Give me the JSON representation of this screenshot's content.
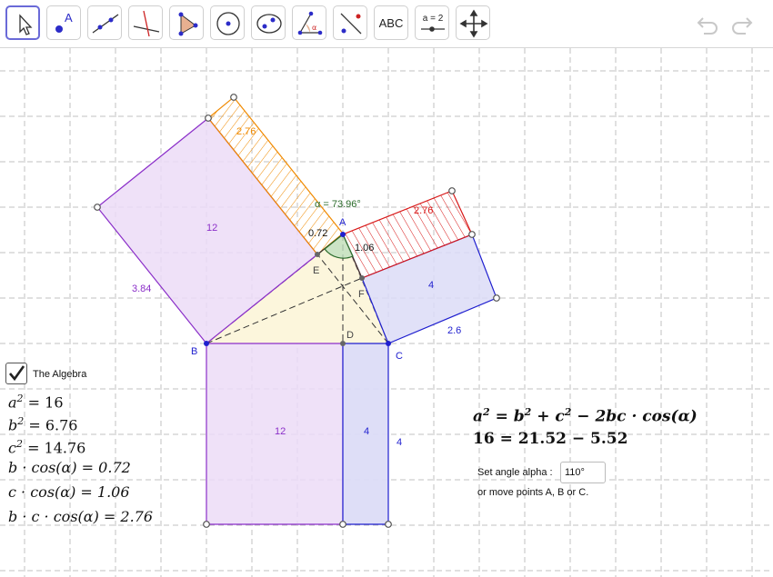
{
  "toolbar": {
    "tools": [
      {
        "name": "move-tool",
        "icon": "cursor-icon"
      },
      {
        "name": "point-tool",
        "icon": "point-icon",
        "label": "A"
      },
      {
        "name": "line-tool",
        "icon": "line-icon"
      },
      {
        "name": "perpendicular-tool",
        "icon": "perpendicular-icon"
      },
      {
        "name": "polygon-tool",
        "icon": "polygon-icon"
      },
      {
        "name": "circle-tool",
        "icon": "circle-icon"
      },
      {
        "name": "ellipse-tool",
        "icon": "ellipse-icon"
      },
      {
        "name": "angle-tool",
        "icon": "angle-icon",
        "label": "α"
      },
      {
        "name": "reflect-tool",
        "icon": "reflect-icon"
      },
      {
        "name": "text-tool",
        "icon": "text-icon",
        "label": "ABC"
      },
      {
        "name": "slider-tool",
        "icon": "slider-icon",
        "label": "a = 2"
      },
      {
        "name": "move-view-tool",
        "icon": "move-view-icon"
      }
    ],
    "undo_icon": "undo-icon",
    "redo_icon": "redo-icon"
  },
  "geometry": {
    "points": {
      "A": "A",
      "B": "B",
      "C": "C",
      "D": "D",
      "E": "E",
      "F": "F"
    },
    "alpha_label": "α = 73.96°",
    "values": {
      "orange_rect_label": "2.76",
      "red_rect_label": "2.76",
      "left_square_label": "12",
      "left_side_label": "3.84",
      "right_square_label": "4",
      "right_side_label": "2.6",
      "bottom_left_label": "12",
      "bottom_right_label": "4",
      "bottom_side_label": "4",
      "proj_b_label": "0.72",
      "proj_c_label": "1.06"
    }
  },
  "algebra": {
    "checkbox_label": "The Algebra",
    "checked": true,
    "lines": [
      {
        "lhs_base": "a",
        "lhs_exp": "2",
        "rhs": "= 16"
      },
      {
        "lhs_base": "b",
        "lhs_exp": "2",
        "rhs": "= 6.76"
      },
      {
        "lhs_base": "c",
        "lhs_exp": "2",
        "rhs": "= 14.76"
      },
      {
        "text": "b · cos(α) = 0.72"
      },
      {
        "text": "c · cos(α) = 1.06"
      },
      {
        "text": "b · c · cos(α) = 2.76"
      }
    ]
  },
  "law": {
    "line1_a": "a",
    "line1_rest_1": " = b",
    "line1_rest_2": " + c",
    "line1_rest_3": " − 2bc · cos(α)",
    "exp": "2",
    "line2": "16 = 21.52 − 5.52"
  },
  "controls": {
    "alpha_label": "Set angle alpha :",
    "alpha_value": "110°",
    "hint": "or move points A, B or C."
  },
  "colors": {
    "grid": "#c0c0c0",
    "purple": "#8b2fc9",
    "purple_fill": "#ecdcf7",
    "blue": "#1f1fcf",
    "blue_fill": "#dcdcf7",
    "orange": "#f08a00",
    "red": "#d81818",
    "triangle_fill": "#fcf6dc",
    "angle_green": "#2b6b2b",
    "accent": "#6a6ad8"
  }
}
